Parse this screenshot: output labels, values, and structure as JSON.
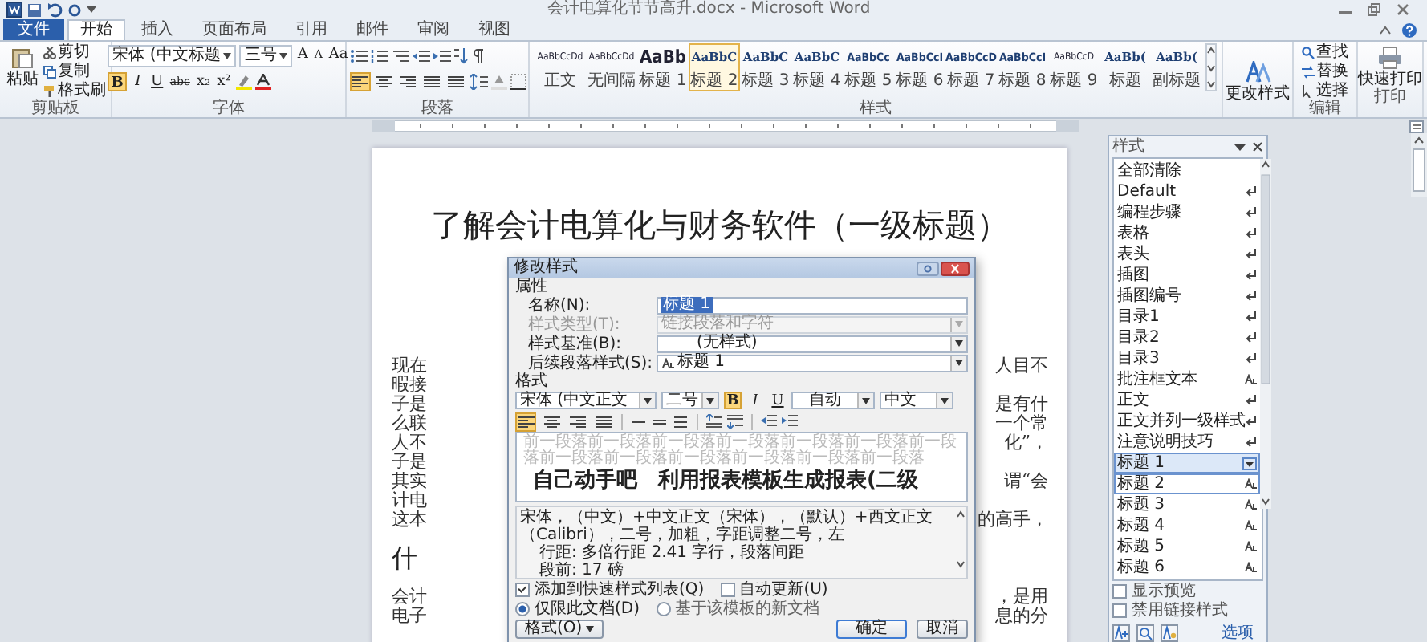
{
  "title_bar": {
    "title": "会计电算化节节高升.docx - Microsoft Word"
  },
  "tabs": [
    {
      "label": "文件",
      "kind": "file",
      "selected": false
    },
    {
      "label": "开始",
      "kind": "tab",
      "selected": true
    },
    {
      "label": "插入",
      "kind": "tab",
      "selected": false
    },
    {
      "label": "页面布局",
      "kind": "tab",
      "selected": false
    },
    {
      "label": "引用",
      "kind": "tab",
      "selected": false
    },
    {
      "label": "邮件",
      "kind": "tab",
      "selected": false
    },
    {
      "label": "审阅",
      "kind": "tab",
      "selected": false
    },
    {
      "label": "视图",
      "kind": "tab",
      "selected": false
    }
  ],
  "ribbon": {
    "clipboard": {
      "paste": "粘贴",
      "items": [
        "剪切",
        "复制",
        "格式刷"
      ],
      "label": "剪贴板"
    },
    "font": {
      "font_name": "宋体 (中文标题",
      "font_size": "三号",
      "size_buttons": [
        "A",
        "A",
        "Aa"
      ],
      "format_buttons": [
        {
          "glyph": "B",
          "on": true
        },
        {
          "glyph": "I",
          "on": false
        },
        {
          "glyph": "U",
          "on": false
        },
        {
          "glyph": "abc",
          "on": false
        },
        {
          "glyph": "x₂",
          "on": false
        },
        {
          "glyph": "x²",
          "on": false
        }
      ],
      "label": "字体"
    },
    "paragraph": {
      "alignments": [
        {
          "selected": true
        },
        {
          "selected": false
        },
        {
          "selected": false
        },
        {
          "selected": false
        },
        {
          "selected": false
        }
      ],
      "label": "段落"
    },
    "styles": {
      "items": [
        {
          "sample": "AaBbCcDd",
          "label": "正文",
          "kind": "small",
          "selected": false
        },
        {
          "sample": "AaBbCcDd",
          "label": "无间隔",
          "kind": "small",
          "selected": false
        },
        {
          "sample": "AaBb",
          "label": "标题 1",
          "kind": "big",
          "selected": false
        },
        {
          "sample": "AaBbC",
          "label": "标题 2",
          "kind": "medium",
          "selected": true
        },
        {
          "sample": "AaBbC",
          "label": "标题 3",
          "kind": "medium",
          "selected": false
        },
        {
          "sample": "AaBbC",
          "label": "标题 4",
          "kind": "medium",
          "selected": false
        },
        {
          "sample": "AaBbCc",
          "label": "标题 5",
          "kind": "normal",
          "selected": false
        },
        {
          "sample": "AaBbCcI",
          "label": "标题 6",
          "kind": "normal",
          "selected": false
        },
        {
          "sample": "AaBbCcD",
          "label": "标题 7",
          "kind": "normal",
          "selected": false
        },
        {
          "sample": "AaBbCcI",
          "label": "标题 8",
          "kind": "normal",
          "selected": false
        },
        {
          "sample": "AaBbCcD",
          "label": "标题 9",
          "kind": "small",
          "selected": false
        },
        {
          "sample": "AaBb(",
          "label": "标题",
          "kind": "medium",
          "selected": false
        },
        {
          "sample": "AaBb(",
          "label": "副标题",
          "kind": "medium",
          "selected": false
        }
      ],
      "label": "样式"
    },
    "change_styles": "更改样式",
    "editing": {
      "items": [
        "查找",
        "替换",
        "选择"
      ],
      "label": "编辑"
    },
    "print": {
      "button": "快速打印",
      "label": "打印"
    }
  },
  "document": {
    "title": "了解会计电算化与财务软件（一级标题）",
    "lines": [
      {
        "left": "现在",
        "right": "人目不"
      },
      {
        "left": "暇接"
      },
      {
        "left": "子是",
        "right": "是有什"
      },
      {
        "left": "么联",
        "right": "一个常"
      },
      {
        "left": "人不",
        "right": "化”，"
      },
      {
        "left": "子是"
      },
      {
        "left": "其实",
        "right": "谓“会"
      },
      {
        "left": "计电"
      },
      {
        "left": "这本",
        "right": "的高手，"
      }
    ],
    "heading": "什",
    "lines2": [
      {
        "left": "会计",
        "right": "，是用"
      },
      {
        "left": "电子",
        "right": "息的分"
      }
    ]
  },
  "dialog": {
    "title": "修改样式",
    "properties_label": "属性",
    "fields": [
      {
        "label": "名称(N):",
        "value": "标题 1",
        "kind": "text",
        "disabled": false
      },
      {
        "label": "样式类型(T):",
        "value": "链接段落和字符",
        "kind": "select",
        "disabled": true
      },
      {
        "label": "样式基准(B):",
        "value": "(无样式)",
        "kind": "select",
        "disabled": false
      },
      {
        "label": "后续段落样式(S):",
        "value": "标题 1",
        "kind": "select",
        "disabled": false
      }
    ],
    "format_label": "格式",
    "font": "宋体 (中文正文",
    "size": "二号",
    "style_buttons": [
      {
        "glyph": "B",
        "on": true
      },
      {
        "glyph": "I",
        "on": false
      },
      {
        "glyph": "U",
        "on": false
      }
    ],
    "font_color_value": "自动",
    "script": "中文",
    "alignments": [
      {
        "selected": true
      },
      {
        "selected": false
      },
      {
        "selected": false
      },
      {
        "selected": false
      }
    ],
    "preview_before": "前一段落前一段落前一段落前一段落前一段落前一段落前一段落前一段落前一段落前一段落前一段落前一段落前一段落",
    "preview_text": "自己动手吧　利用报表模板生成报表(二级",
    "description": [
      "宋体，（中文）+中文正文（宋体），（默认）+西文正文（Calibri），二号，加粗，字距调整二号，左",
      "行距: 多倍行距 2.41 字行，段落间距",
      "段前: 17 磅"
    ],
    "checks": [
      {
        "label": "添加到快速样式列表(Q)",
        "checked": true
      },
      {
        "label": "自动更新(U)",
        "checked": false
      }
    ],
    "radios": [
      {
        "label": "仅限此文档(D)",
        "selected": true
      },
      {
        "label": "基于该模板的新文档",
        "selected": false
      }
    ],
    "format_button": "格式(O)",
    "ok": "确定",
    "cancel": "取消"
  },
  "styles_pane": {
    "title": "样式",
    "items": [
      {
        "label": "全部清除",
        "kind": "clear",
        "selected": false,
        "hover": false
      },
      {
        "label": "Default",
        "kind": "paragraph",
        "selected": false,
        "hover": false
      },
      {
        "label": "编程步骤",
        "kind": "paragraph",
        "selected": false,
        "hover": false
      },
      {
        "label": "表格",
        "kind": "paragraph",
        "selected": false,
        "hover": false
      },
      {
        "label": "表头",
        "kind": "paragraph",
        "selected": false,
        "hover": false
      },
      {
        "label": "插图",
        "kind": "paragraph",
        "selected": false,
        "hover": false
      },
      {
        "label": "插图编号",
        "kind": "paragraph",
        "selected": false,
        "hover": false
      },
      {
        "label": "目录1",
        "kind": "paragraph",
        "selected": false,
        "hover": false
      },
      {
        "label": "目录2",
        "kind": "paragraph",
        "selected": false,
        "hover": false
      },
      {
        "label": "目录3",
        "kind": "paragraph",
        "selected": false,
        "hover": false
      },
      {
        "label": "批注框文本",
        "kind": "linked",
        "selected": false,
        "hover": false
      },
      {
        "label": "正文",
        "kind": "paragraph",
        "selected": false,
        "hover": false
      },
      {
        "label": "正文并列一级样式",
        "kind": "paragraph",
        "selected": false,
        "hover": false
      },
      {
        "label": "注意说明技巧",
        "kind": "paragraph",
        "selected": false,
        "hover": false
      },
      {
        "label": "标题 1",
        "kind": "linked",
        "selected": true,
        "hover": false
      },
      {
        "label": "标题 2",
        "kind": "linked",
        "selected": false,
        "hover": true
      },
      {
        "label": "标题 3",
        "kind": "linked",
        "selected": false,
        "hover": false
      },
      {
        "label": "标题 4",
        "kind": "linked",
        "selected": false,
        "hover": false
      },
      {
        "label": "标题 5",
        "kind": "linked",
        "selected": false,
        "hover": false
      },
      {
        "label": "标题 6",
        "kind": "linked",
        "selected": false,
        "hover": false
      }
    ],
    "options": [
      {
        "label": "显示预览",
        "checked": false
      },
      {
        "label": "禁用链接样式",
        "checked": false
      }
    ],
    "link": "选项"
  }
}
